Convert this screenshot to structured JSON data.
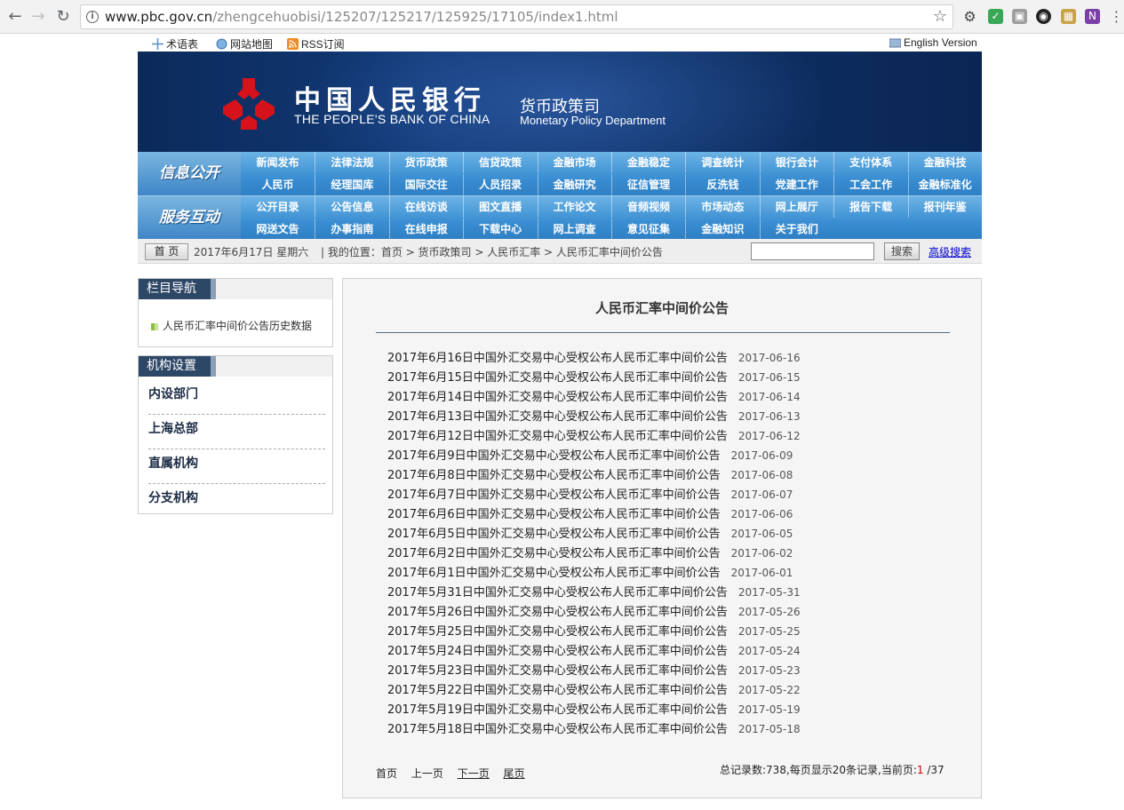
{
  "browser": {
    "url_host": "www.pbc.gov.cn",
    "url_path": "/zhengcehuobisi/125207/125217/125925/17105/index1.html"
  },
  "topbar": {
    "glossary": "术语表",
    "sitemap": "网站地图",
    "rss": "RSS订阅",
    "english": "English Version"
  },
  "banner": {
    "bank_cn": "中国人民银行",
    "bank_en": "THE PEOPLE'S BANK OF CHINA",
    "dept_cn": "货币政策司",
    "dept_en": "Monetary Policy Department",
    "logo_color": "#d6121b"
  },
  "menu": {
    "info_title": "信息公开",
    "service_title": "服务互动",
    "info_row1": [
      "新闻发布",
      "法律法规",
      "货币政策",
      "信贷政策",
      "金融市场",
      "金融稳定",
      "调查统计",
      "银行会计",
      "支付体系",
      "金融科技"
    ],
    "info_row2": [
      "人民币",
      "经理国库",
      "国际交往",
      "人员招录",
      "金融研究",
      "征信管理",
      "反洗钱",
      "党建工作",
      "工会工作",
      "金融标准化"
    ],
    "service_row1": [
      "公开目录",
      "公告信息",
      "在线访谈",
      "图文直播",
      "工作论文",
      "音频视频",
      "市场动态",
      "网上展厅",
      "报告下载",
      "报刊年鉴"
    ],
    "service_row2": [
      "网送文告",
      "办事指南",
      "在线申报",
      "下载中心",
      "网上调查",
      "意见征集",
      "金融知识",
      "关于我们"
    ]
  },
  "crumb": {
    "home": "首 页",
    "date": "2017年6月17日 星期六",
    "location": "|  我的位置：首页 > 货币政策司 > 人民币汇率 > 人民币汇率中间价公告",
    "search_btn": "搜索",
    "advanced": "高级搜索"
  },
  "left": {
    "nav_title": "栏目导航",
    "nav_link": "人民币汇率中间价公告历史数据",
    "org_title": "机构设置",
    "org_items": [
      "内设部门",
      "上海总部",
      "直属机构",
      "分支机构"
    ]
  },
  "main": {
    "title": "人民币汇率中间价公告",
    "items": [
      {
        "title": "2017年6月16日中国外汇交易中心受权公布人民币汇率中间价公告",
        "date": "2017-06-16"
      },
      {
        "title": "2017年6月15日中国外汇交易中心受权公布人民币汇率中间价公告",
        "date": "2017-06-15"
      },
      {
        "title": "2017年6月14日中国外汇交易中心受权公布人民币汇率中间价公告",
        "date": "2017-06-14"
      },
      {
        "title": "2017年6月13日中国外汇交易中心受权公布人民币汇率中间价公告",
        "date": "2017-06-13"
      },
      {
        "title": "2017年6月12日中国外汇交易中心受权公布人民币汇率中间价公告",
        "date": "2017-06-12"
      },
      {
        "title": "2017年6月9日中国外汇交易中心受权公布人民币汇率中间价公告",
        "date": "2017-06-09"
      },
      {
        "title": "2017年6月8日中国外汇交易中心受权公布人民币汇率中间价公告",
        "date": "2017-06-08"
      },
      {
        "title": "2017年6月7日中国外汇交易中心受权公布人民币汇率中间价公告",
        "date": "2017-06-07"
      },
      {
        "title": "2017年6月6日中国外汇交易中心受权公布人民币汇率中间价公告",
        "date": "2017-06-06"
      },
      {
        "title": "2017年6月5日中国外汇交易中心受权公布人民币汇率中间价公告",
        "date": "2017-06-05"
      },
      {
        "title": "2017年6月2日中国外汇交易中心受权公布人民币汇率中间价公告",
        "date": "2017-06-02"
      },
      {
        "title": "2017年6月1日中国外汇交易中心受权公布人民币汇率中间价公告",
        "date": "2017-06-01"
      },
      {
        "title": "2017年5月31日中国外汇交易中心受权公布人民币汇率中间价公告",
        "date": "2017-05-31"
      },
      {
        "title": "2017年5月26日中国外汇交易中心受权公布人民币汇率中间价公告",
        "date": "2017-05-26"
      },
      {
        "title": "2017年5月25日中国外汇交易中心受权公布人民币汇率中间价公告",
        "date": "2017-05-25"
      },
      {
        "title": "2017年5月24日中国外汇交易中心受权公布人民币汇率中间价公告",
        "date": "2017-05-24"
      },
      {
        "title": "2017年5月23日中国外汇交易中心受权公布人民币汇率中间价公告",
        "date": "2017-05-23"
      },
      {
        "title": "2017年5月22日中国外汇交易中心受权公布人民币汇率中间价公告",
        "date": "2017-05-22"
      },
      {
        "title": "2017年5月19日中国外汇交易中心受权公布人民币汇率中间价公告",
        "date": "2017-05-19"
      },
      {
        "title": "2017年5月18日中国外汇交易中心受权公布人民币汇率中间价公告",
        "date": "2017-05-18"
      }
    ],
    "pager": {
      "first": "首页",
      "prev": "上一页",
      "next": "下一页",
      "last": "尾页"
    },
    "stats_prefix": "总记录数:738,每页显示20条记录,当前页:",
    "current_page": "1",
    "stats_suffix": "/37"
  }
}
